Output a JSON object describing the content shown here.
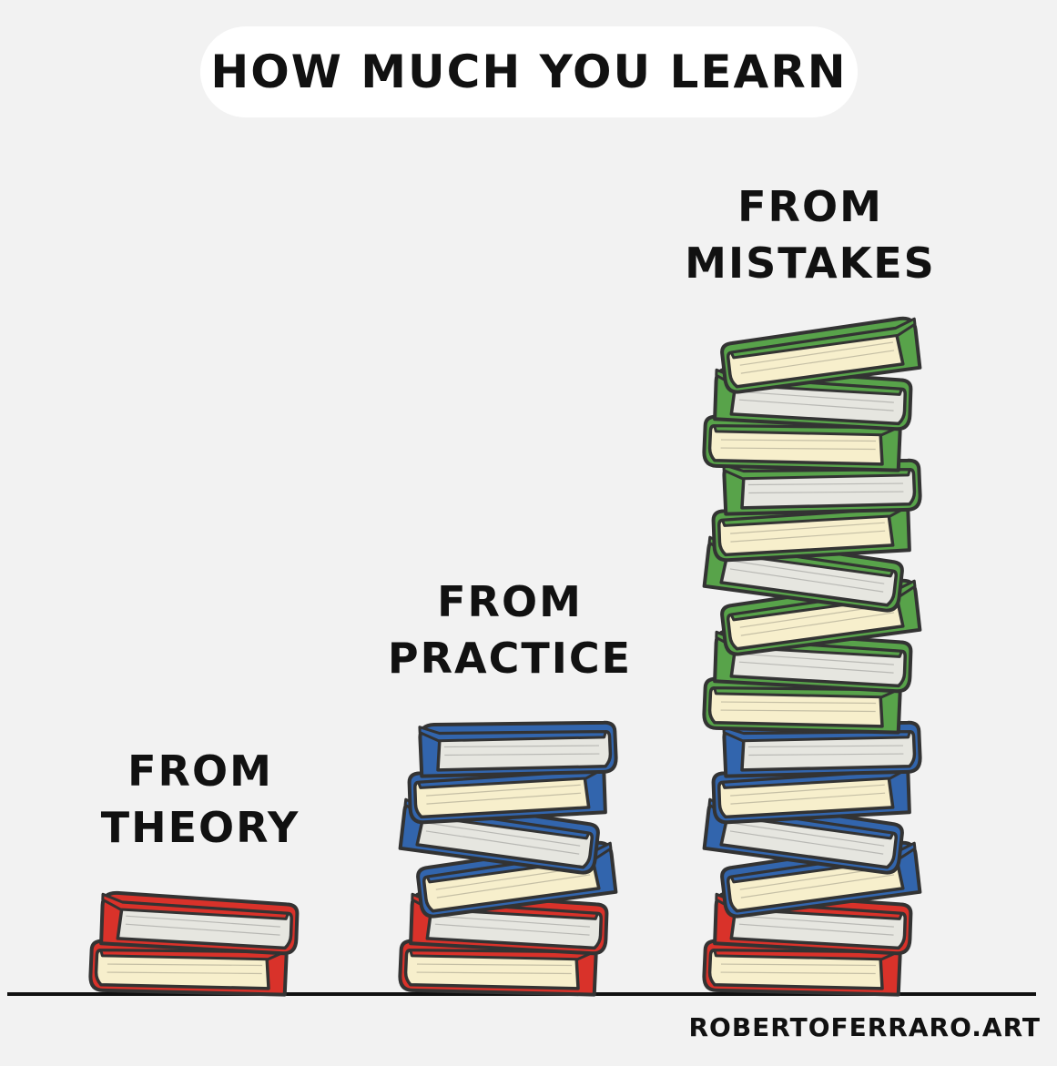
{
  "title": "HOW MUCH YOU LEARN",
  "credit": "ROBERTOFERRARO.ART",
  "colors": {
    "background": "#f2f2f2",
    "ink": "#333333",
    "pages": "#f7efcc",
    "pages_alt": "#e6e6e0",
    "red": "#d9322a",
    "blue": "#3265ad",
    "green": "#58a34a"
  },
  "stacks": [
    {
      "label_line1": "FROM",
      "label_line2": "THEORY",
      "books": [
        "red",
        "red"
      ]
    },
    {
      "label_line1": "FROM",
      "label_line2": "PRACTICE",
      "books": [
        "red",
        "red",
        "blue",
        "blue",
        "blue",
        "blue"
      ]
    },
    {
      "label_line1": "FROM",
      "label_line2": "MISTAKES",
      "books": [
        "red",
        "red",
        "blue",
        "blue",
        "blue",
        "blue",
        "green",
        "green",
        "green",
        "green",
        "green",
        "green",
        "green",
        "green",
        "green"
      ]
    }
  ]
}
